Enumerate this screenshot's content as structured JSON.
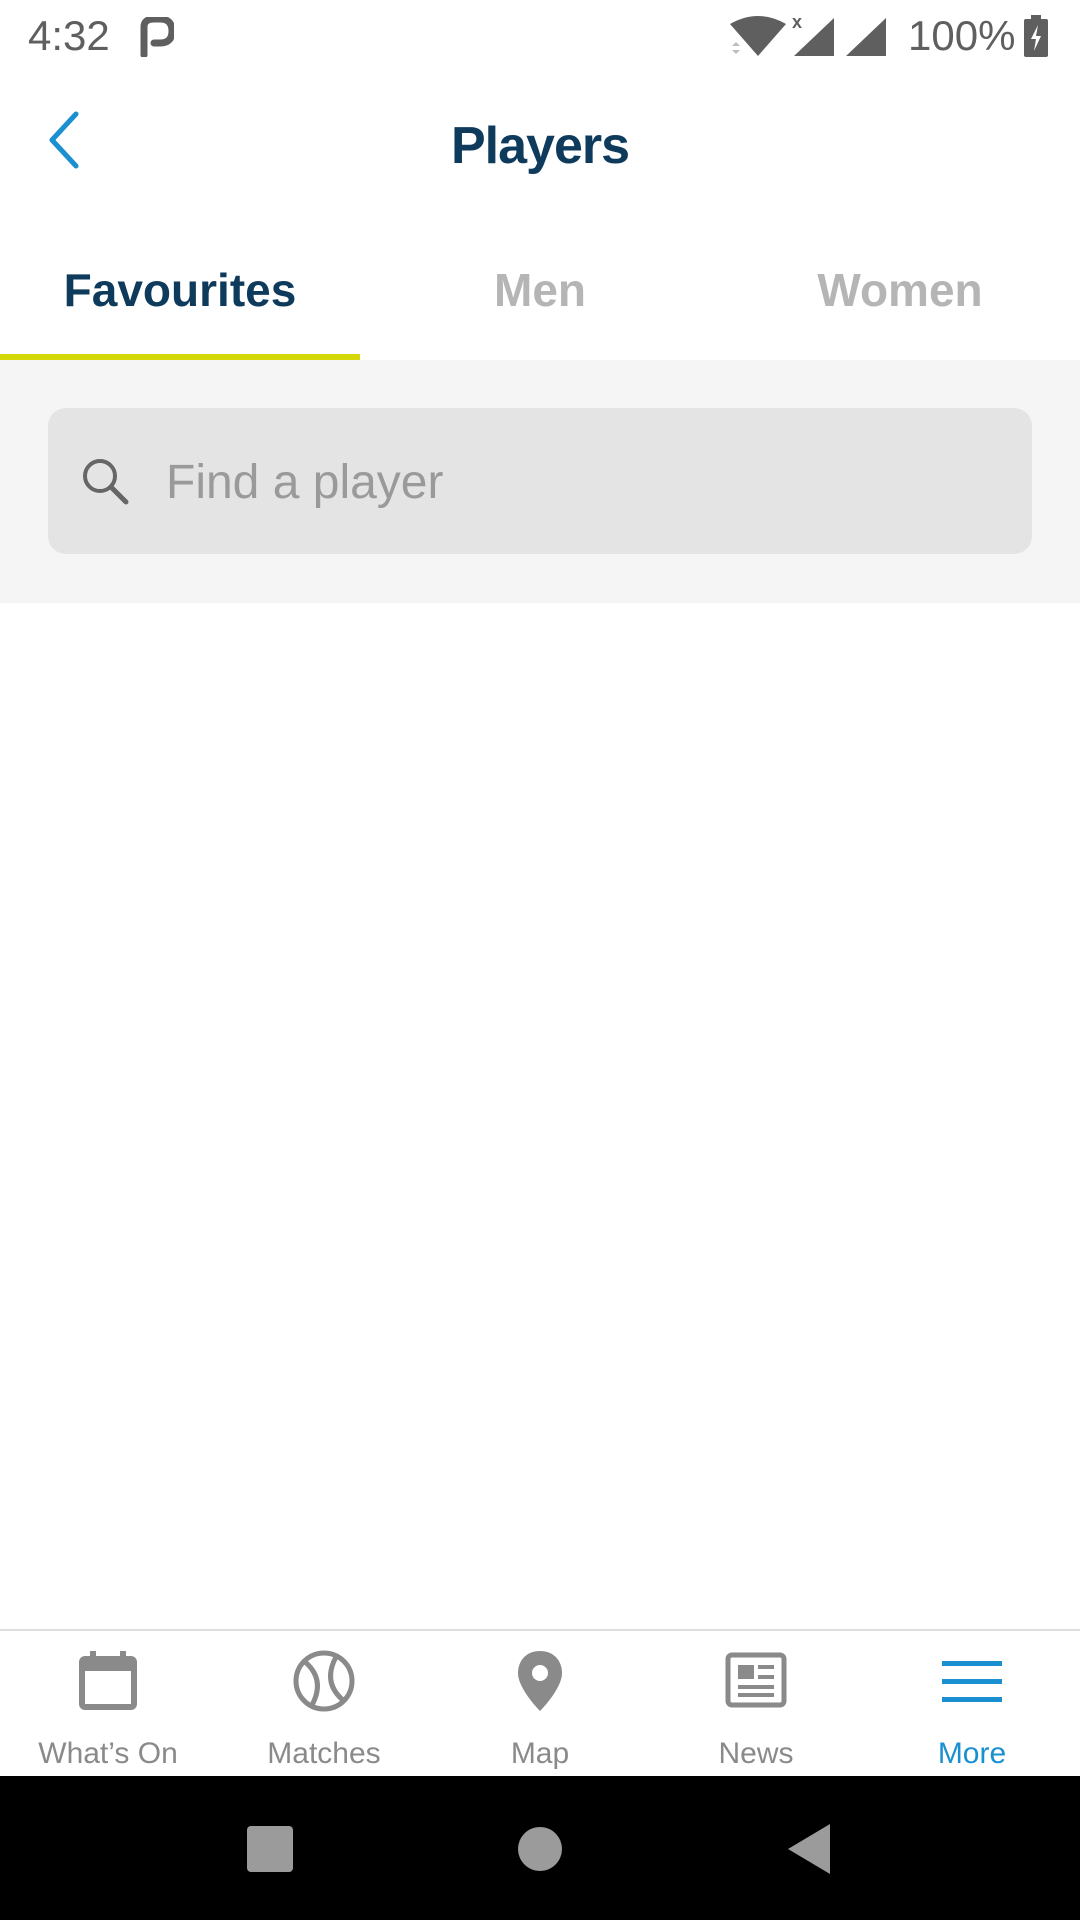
{
  "status_bar": {
    "time": "4:32",
    "battery": "100%",
    "network_mark": "x"
  },
  "header": {
    "title": "Players"
  },
  "tabs": [
    {
      "label": "Favourites",
      "active": true
    },
    {
      "label": "Men",
      "active": false
    },
    {
      "label": "Women",
      "active": false
    }
  ],
  "search": {
    "placeholder": "Find a player",
    "value": ""
  },
  "bottom_nav": [
    {
      "label": "What’s On",
      "icon": "calendar-icon",
      "active": false
    },
    {
      "label": "Matches",
      "icon": "tennis-ball-icon",
      "active": false
    },
    {
      "label": "Map",
      "icon": "map-pin-icon",
      "active": false
    },
    {
      "label": "News",
      "icon": "newspaper-icon",
      "active": false
    },
    {
      "label": "More",
      "icon": "menu-icon",
      "active": true
    }
  ],
  "colors": {
    "title": "#0e3a5c",
    "tab_indicator": "#d4d80a",
    "accent_blue": "#1a90d0",
    "inactive": "#8a8a8a"
  }
}
